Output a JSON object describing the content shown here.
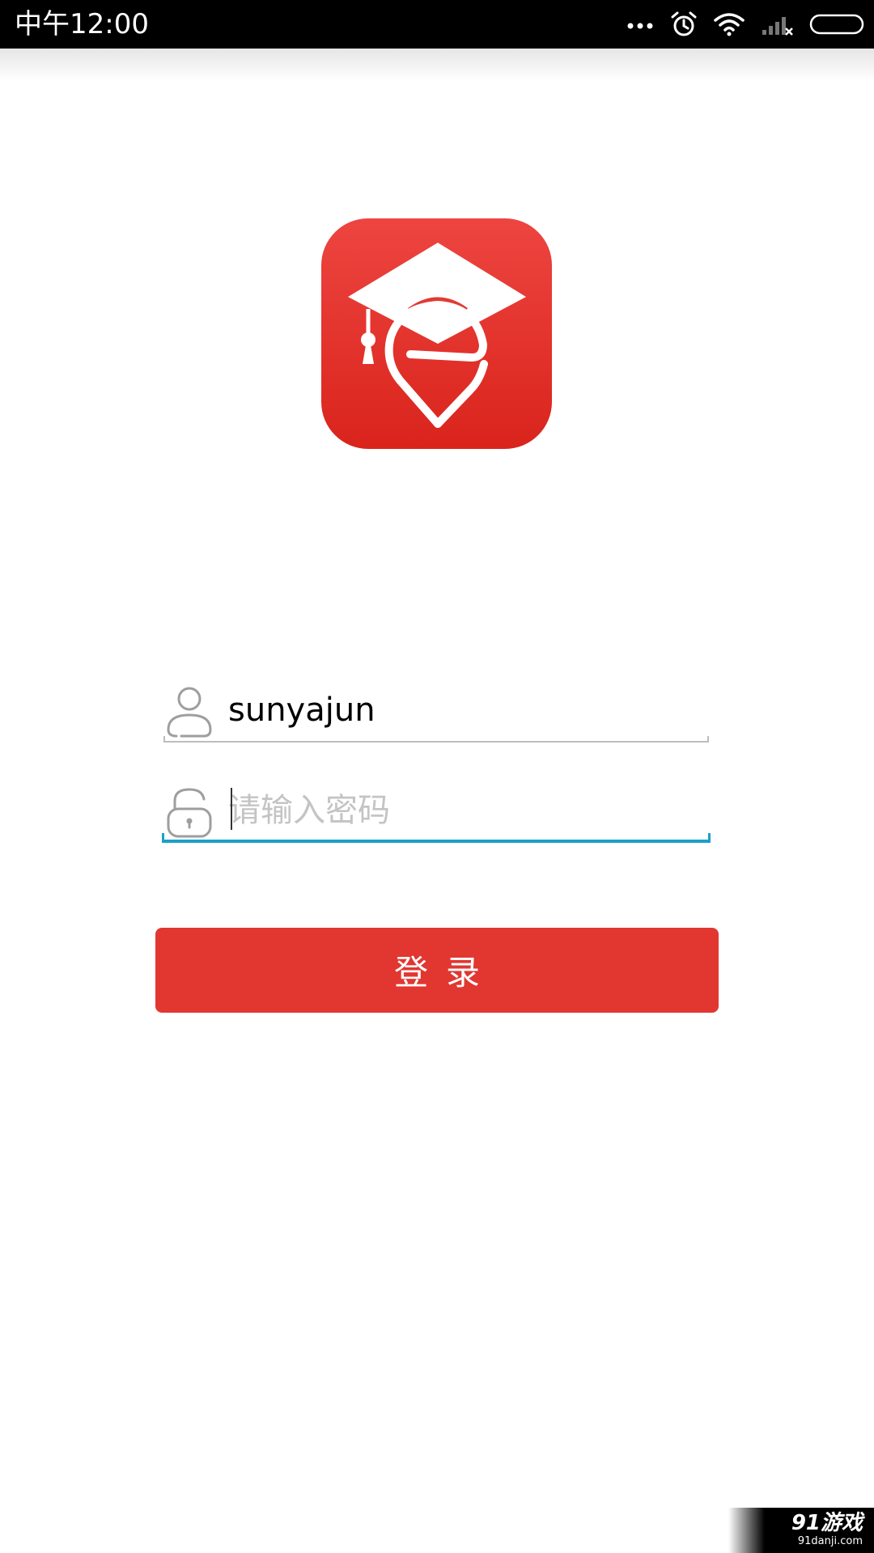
{
  "status_bar": {
    "time": "中午12:00",
    "icons": [
      "more-dots-icon",
      "alarm-icon",
      "wifi-icon",
      "signal-no-sim-icon",
      "battery-icon"
    ]
  },
  "logo": {
    "icon": "graduation-cap-e-pin-logo",
    "color": "#e8342c"
  },
  "login_form": {
    "username": {
      "value": "sunyajun",
      "icon": "user-icon"
    },
    "password": {
      "placeholder": "请输入密码",
      "icon": "lock-icon",
      "focused": true
    },
    "submit_label": "登录"
  },
  "watermark": {
    "logo_text": "91游戏",
    "url": "91danji.com"
  },
  "colors": {
    "accent": "#e23631",
    "focus": "#1aa0c9",
    "placeholder": "#c4c4c4"
  }
}
